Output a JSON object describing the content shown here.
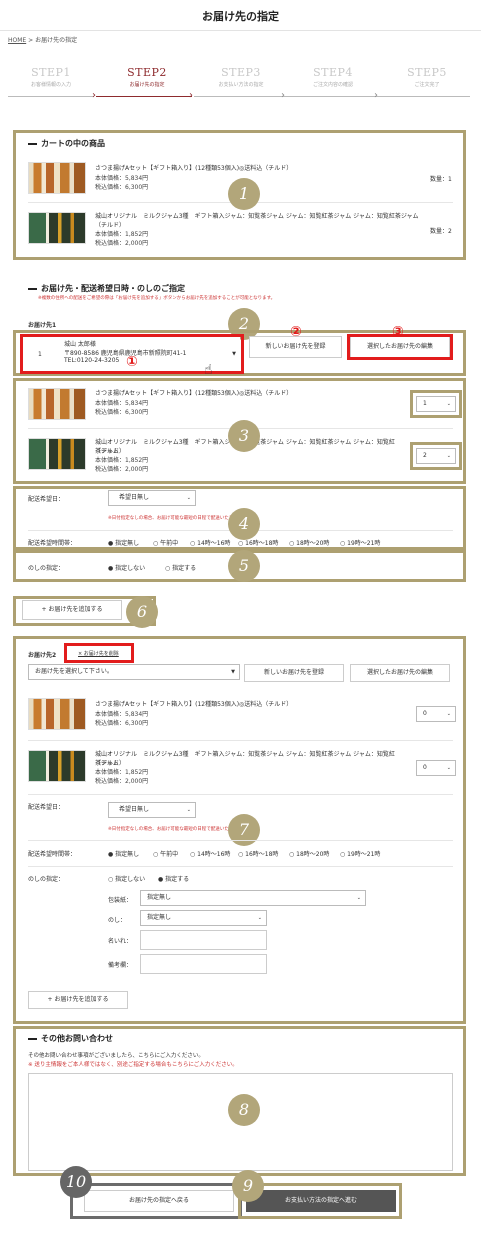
{
  "page": {
    "title": "お届け先の指定"
  },
  "breadcrumb": {
    "home": "HOME",
    "sep": ">",
    "current": "お届け先の指定"
  },
  "steps": [
    {
      "num": "STEP1",
      "label": "お客様情報の入力"
    },
    {
      "num": "STEP2",
      "label": "お届け先の指定"
    },
    {
      "num": "STEP3",
      "label": "お支払い方法の指定"
    },
    {
      "num": "STEP4",
      "label": "ご注文内容の確認"
    },
    {
      "num": "STEP5",
      "label": "ご注文完了"
    }
  ],
  "cart": {
    "title": "カートの中の商品",
    "items": [
      {
        "name": "さつま揚げAセット【ギフト箱入り】(12種類53個入)◎送料込（チルド）",
        "price": "本体価格：5,834円",
        "tax_price": "税込価格：6,300円",
        "qty": "数量：1"
      },
      {
        "name": "城山オリジナル　ミルクジャム3種　ギフト箱入ジャム：知覧茶ジャム ジャム：知覧紅茶ジャム ジャム：知覧紅茶ジャム",
        "name2": "（チルド）",
        "price": "本体価格：1,852円",
        "tax_price": "税込価格：2,000円",
        "qty": "数量：2"
      }
    ]
  },
  "delivery": {
    "title": "お届け先・配送希望日時・のしのご指定",
    "note": "※複数の住所への配送をご希望の際は「お届け先を追加する」ボタンからお届け先を追加することが可能となります。",
    "dest1_label": "お届け先1",
    "address": {
      "index": "1",
      "name": "城山 太郎様",
      "addr": "〒890-8586 鹿児島県鹿児島市新照院町41-1",
      "tel": "TEL:0120-24-3205"
    },
    "register_new": "新しいお届け先を登録",
    "edit_selected": "選択したお届け先の編集",
    "qty_select_1": "1",
    "qty_select_2": "2",
    "date_label": "配送希望日：",
    "date_value": "希望日無し",
    "date_note": "※日付指定なしの場合、お届け可能な最短の日程で配送いたします。",
    "time_label": "配送希望時間帯：",
    "time_options": [
      "指定無し",
      "午前中",
      "14時〜16時",
      "16時〜18時",
      "18時〜20時",
      "19時〜21時"
    ],
    "noshi_label": "のしの指定：",
    "noshi_options": [
      "指定しない",
      "指定する"
    ],
    "add_dest": "+ お届け先を追加する"
  },
  "dest2": {
    "label": "お届け先2",
    "delete": "× お届け先を削除",
    "select_placeholder": "お届け先を選択して下さい。",
    "register_new": "新しいお届け先を登録",
    "edit_selected": "選択したお届け先の編集",
    "qty_select_1": "0",
    "qty_select_2": "0",
    "date_label": "配送希望日：",
    "date_value": "希望日無し",
    "date_note": "※日付指定なしの場合、お届け可能な最短の日程で配送いたします。",
    "time_label": "配送希望時間帯：",
    "time_options": [
      "指定無し",
      "午前中",
      "14時〜16時",
      "16時〜18時",
      "18時〜20時",
      "19時〜21時"
    ],
    "noshi_label": "のしの指定：",
    "noshi_options": [
      "指定しない",
      "指定する"
    ],
    "wrap_label": "包装紙：",
    "wrap_value": "指定無し",
    "noshi_type_label": "のし：",
    "noshi_type_value": "指定無し",
    "name_label": "名いれ：",
    "memo_label": "備考欄：",
    "add_dest": "+ お届け先を追加する"
  },
  "inquiry": {
    "title": "その他お問い合わせ",
    "text1": "その他お問い合わせ事項がございましたら、こちらにご入力ください。",
    "text2": "※ 送り主情報をご本人様ではなく、別途ご指定する場合もこちらにご入力ください。"
  },
  "footer": {
    "back": "お届け先の指定へ戻る",
    "next": "お支払い方法の指定へ進む"
  },
  "badges": [
    "1",
    "2",
    "3",
    "4",
    "5",
    "6",
    "7",
    "8",
    "9",
    "10"
  ],
  "red_nums": [
    "①",
    "②",
    "③"
  ]
}
